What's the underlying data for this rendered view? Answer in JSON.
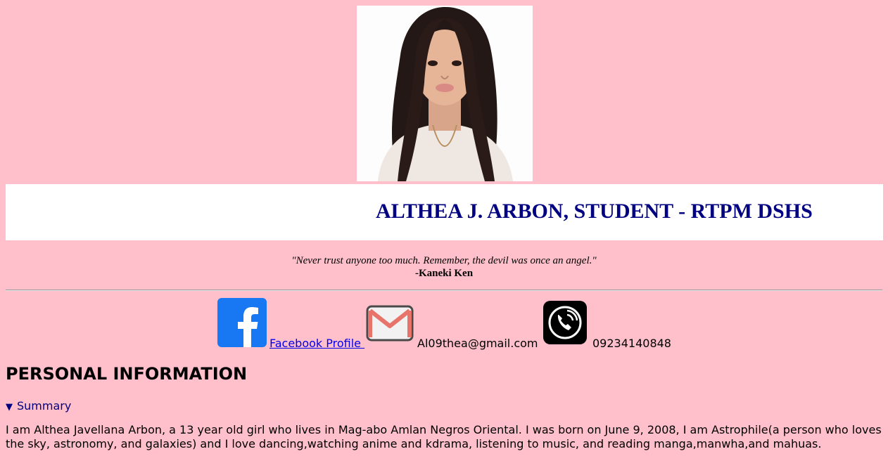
{
  "profile": {
    "name_title": "ALTHEA J. ARBON, STUDENT - RTPM DSHS",
    "photo_alt": "profile-photo"
  },
  "quote": {
    "text": "\"Never trust anyone too much. Remember, the devil was once an angel.\"",
    "author": "-Kaneki Ken"
  },
  "contacts": {
    "facebook_label": "Facebook Profile ",
    "email": "Al09thea@gmail.com",
    "phone": "09234140848"
  },
  "icons": {
    "facebook": "facebook-icon",
    "email": "mail-icon",
    "phone": "phone-icon"
  },
  "personal": {
    "heading": "PERSONAL INFORMATION",
    "summary_label": "Summary",
    "bio": "I am Althea Javellana Arbon, a 13 year old girl who lives in Mag-abo Amlan Negros Oriental. I was born on June 9, 2008, I am Astrophile(a person who loves the sky, astronomy, and galaxies) and I love dancing,watching anime and kdrama, listening to music, and reading manga,manwha,and mahuas."
  },
  "colors": {
    "page_bg": "#ffc0cb",
    "title": "#000080",
    "link": "#0000ee",
    "facebook_blue": "#1877f2"
  }
}
